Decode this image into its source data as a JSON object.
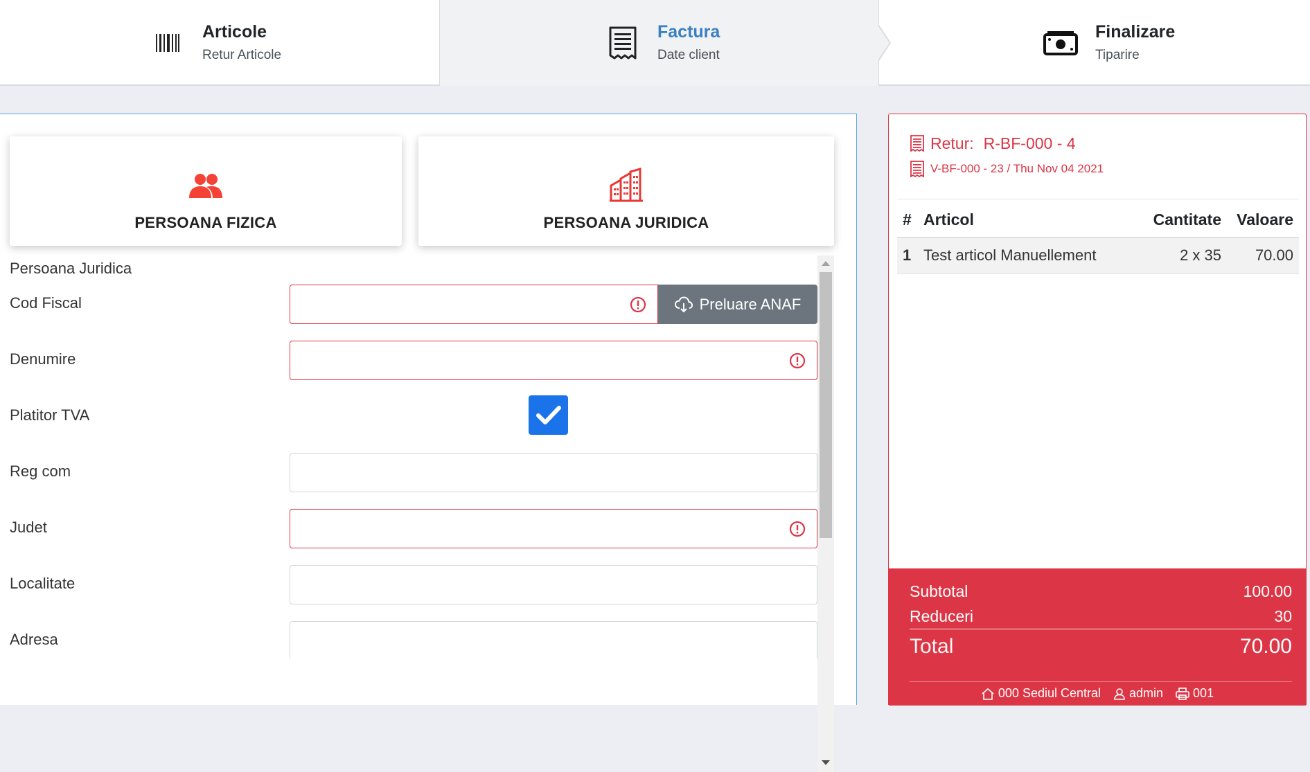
{
  "steps": [
    {
      "title": "Articole",
      "subtitle": "Retur Articole",
      "icon": "barcode-icon"
    },
    {
      "title": "Factura",
      "subtitle": "Date client",
      "icon": "receipt-icon"
    },
    {
      "title": "Finalizare",
      "subtitle": "Tiparire",
      "icon": "cash-icon"
    }
  ],
  "client_types": {
    "fizica": {
      "label": "PERSOANA FIZICA",
      "icon": "people-icon"
    },
    "juridica": {
      "label": "PERSOANA JURIDICA",
      "icon": "building-icon"
    }
  },
  "form": {
    "section_title": "Persoana Juridica",
    "fields": {
      "cod_fiscal": {
        "label": "Cod Fiscal",
        "value": "",
        "invalid": true
      },
      "denumire": {
        "label": "Denumire",
        "value": "",
        "invalid": true
      },
      "platitor_tva": {
        "label": "Platitor TVA",
        "checked": true
      },
      "reg_com": {
        "label": "Reg com",
        "value": ""
      },
      "judet": {
        "label": "Judet",
        "value": "",
        "invalid": true
      },
      "localitate": {
        "label": "Localitate",
        "value": ""
      },
      "adresa": {
        "label": "Adresa",
        "value": ""
      }
    },
    "anaf_button": "Preluare ANAF"
  },
  "receipt": {
    "retur_label": "Retur:",
    "retur_number": "R-BF-000 - 4",
    "source_doc": "V-BF-000 - 23 / Thu Nov 04 2021",
    "columns": [
      "#",
      "Articol",
      "Cantitate",
      "Valoare"
    ],
    "items": [
      {
        "no": "1",
        "name": "Test articol Manuellement",
        "qty": "2 x 35",
        "value": "70.00"
      }
    ],
    "totals": {
      "subtotal_label": "Subtotal",
      "subtotal": "100.00",
      "reduceri_label": "Reduceri",
      "reduceri": "30",
      "total_label": "Total",
      "total": "70.00"
    },
    "footer": {
      "location": "000 Sediul Central",
      "user": "admin",
      "printer": "001"
    }
  },
  "colors": {
    "accent": "#dc3545",
    "active_step": "#3a7fc1",
    "checkbox": "#1a73e8",
    "button": "#6c757d"
  }
}
